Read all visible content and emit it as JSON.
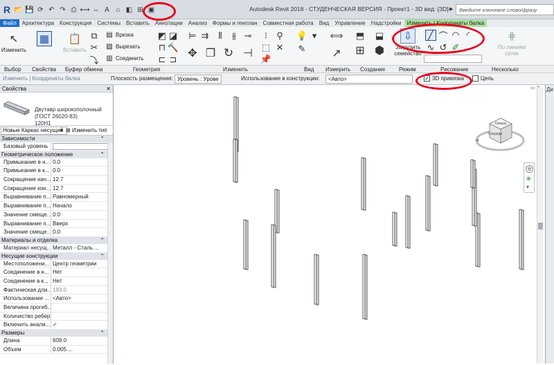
{
  "titlebar": {
    "title": "Autodesk Revit 2018 - СТУДЕНЧЕСКАЯ ВЕРСИЯ -   Проект1 - 3D вид: {3D}",
    "search_placeholder": "Введите ключевое слово/фразу"
  },
  "tabs": [
    "Файл",
    "Архитектура",
    "Конструкция",
    "Системы",
    "Вставить",
    "Аннотации",
    "Анализ",
    "Формы и генплан",
    "Совместная работа",
    "Вид",
    "Управление",
    "Надстройки",
    "Изменить | Координаты балка"
  ],
  "ribbon": {
    "modify": "Изменить",
    "paste": "Вставить",
    "cut": "Врезка",
    "cut_out": "Вырезать",
    "join": "Соединить",
    "load_family": "Загрузить семейство",
    "on_gridlines": "По линиям сетки"
  },
  "panels": {
    "select": "Выбор",
    "properties": "Свойства",
    "clipboard": "Буфер обмена",
    "geometry": "Геометрия",
    "modify": "Изменить",
    "view": "Вид",
    "measure": "Измерить",
    "create": "Создание",
    "mode": "Режим",
    "draw": "Рисование",
    "multiple": "Несколько"
  },
  "context_label": "Изменить | Координаты балка",
  "options_bar": {
    "placement_plane_label": "Плоскость размещения:",
    "placement_plane_value": "Уровень : Урове",
    "structural_usage_label": "Использование в конструкции:",
    "structural_usage_value": "<Авто>",
    "snap3d_label": "3D привязка",
    "snap3d_checked": true,
    "chain_label": "Цепь",
    "chain_checked": false
  },
  "properties": {
    "title": "Свойства",
    "family_name": "Двутавр широкополочный (ГОСТ 26020-83)",
    "type_name": "120Н1",
    "type_selector": "Новые Каркас несущий",
    "edit_type": "Изменить тип",
    "categories": [
      {
        "name": "Зависимости",
        "rows": [
          {
            "name": "Базовый уровень",
            "value": "",
            "style": "box"
          }
        ]
      },
      {
        "name": "Геометрическое положение",
        "rows": [
          {
            "name": "Примыкание в н...",
            "value": "0.0"
          },
          {
            "name": "Примыкание в к...",
            "value": "0.0"
          },
          {
            "name": "Сокращение нач...",
            "value": "12.7"
          },
          {
            "name": "Сокращение кон...",
            "value": "12.7"
          },
          {
            "name": "Выравнивание п...",
            "value": "Равномерный"
          },
          {
            "name": "Выравнивание п...",
            "value": "Начало"
          },
          {
            "name": "Значение смеще...",
            "value": "0.0"
          },
          {
            "name": "Выравнивание п...",
            "value": "Вверх"
          },
          {
            "name": "Значение смеще...",
            "value": "0.0"
          }
        ]
      },
      {
        "name": "Материалы и отделка",
        "rows": [
          {
            "name": "Материал несущ...",
            "value": "Металл - Сталь ..."
          }
        ]
      },
      {
        "name": "Несущие конструкции",
        "rows": [
          {
            "name": "Местоположени...",
            "value": "Центр геометрии"
          },
          {
            "name": "Соединение в н...",
            "value": "Нет"
          },
          {
            "name": "Соединение в к...",
            "value": "Нет"
          },
          {
            "name": "Фактическая дли...",
            "value": "193.0",
            "style": "gray"
          },
          {
            "name": "Использование ...",
            "value": "<Авто>"
          },
          {
            "name": "Величина прогиб...",
            "value": ""
          },
          {
            "name": "Количество ребер",
            "value": ""
          },
          {
            "name": "Включить анали...",
            "value": "✓"
          }
        ]
      },
      {
        "name": "Размеры",
        "rows": [
          {
            "name": "Длина",
            "value": "609.0"
          },
          {
            "name": "Объем",
            "value": "0.005 ..."
          }
        ]
      }
    ]
  },
  "viewcube": {
    "top_label": "Сверху",
    "front_label": "Спереди"
  },
  "right_panel_title": "Ди",
  "colors": {
    "file_tab": "#1e6fcb",
    "context_tab": "#aee0a0",
    "annotation": "#e8001e"
  }
}
